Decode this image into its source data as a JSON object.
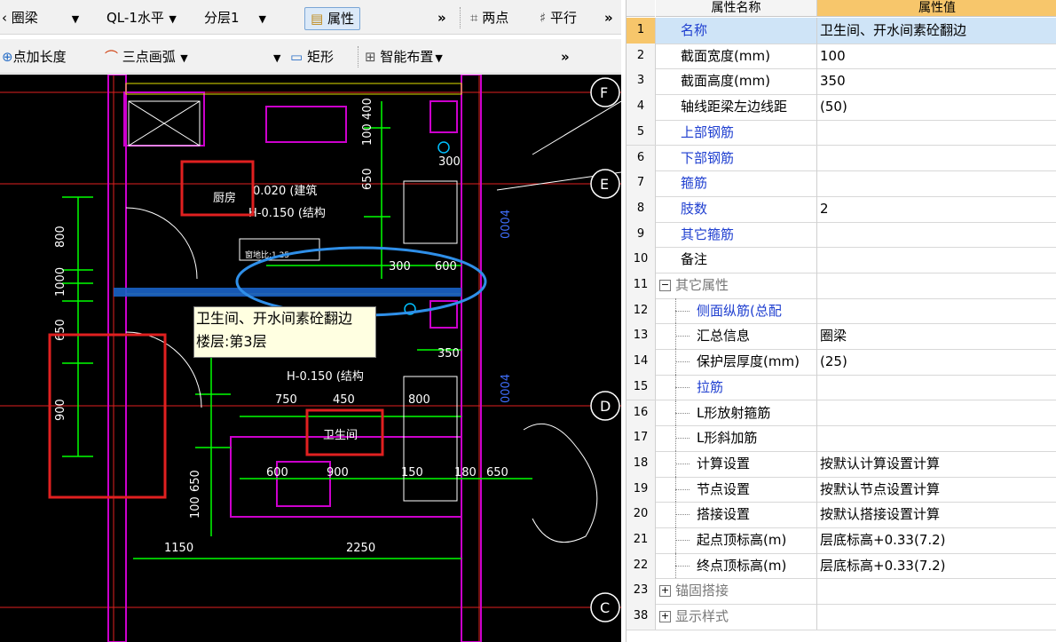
{
  "toolbar1": {
    "type_label": "圈梁",
    "code_label": "QL-1水平",
    "layer_label": "分层1",
    "properties_label": "属性",
    "two_point_label": "两点",
    "parallel_label": "平行"
  },
  "toolbar2": {
    "point_length_label": "点加长度",
    "three_point_arc_label": "三点画弧",
    "rect_label": "矩形",
    "smart_layout_label": "智能布置"
  },
  "cad": {
    "axis_labels": [
      "F",
      "E",
      "D",
      "C"
    ],
    "room_kitchen": "厨房",
    "room_bathroom": "卫生间",
    "elev_built": "0.020 (建筑",
    "elev_struct": "H-0.150 (结构",
    "elev_struct2": "H-0.150 (结构",
    "ratio_label": "窗地比:1.25",
    "dims": [
      "800",
      "1000",
      "650",
      "900",
      "650",
      "100",
      "1150",
      "2250",
      "750",
      "450",
      "800",
      "300",
      "600",
      "350",
      "300",
      "100 400",
      "650",
      "600",
      "600",
      "900",
      "150",
      "180",
      "650"
    ],
    "vertical_dims": [
      "0004",
      "0004"
    ]
  },
  "tooltip": {
    "line1": "卫生间、开水间素砼翻边",
    "line2": "楼层:第3层"
  },
  "panel": {
    "header_name": "属性名称",
    "header_value": "属性值",
    "rows": [
      {
        "num": "1",
        "name": "名称",
        "value": "卫生间、开水间素砼翻边",
        "style": "blue",
        "selected": true
      },
      {
        "num": "2",
        "name": "截面宽度(mm)",
        "value": "100",
        "style": "normal"
      },
      {
        "num": "3",
        "name": "截面高度(mm)",
        "value": "350",
        "style": "normal"
      },
      {
        "num": "4",
        "name": "轴线距梁左边线距",
        "value": "(50)",
        "style": "normal"
      },
      {
        "num": "5",
        "name": "上部钢筋",
        "value": "",
        "style": "blue"
      },
      {
        "num": "6",
        "name": "下部钢筋",
        "value": "",
        "style": "blue"
      },
      {
        "num": "7",
        "name": "箍筋",
        "value": "",
        "style": "blue"
      },
      {
        "num": "8",
        "name": "肢数",
        "value": "2",
        "style": "blue"
      },
      {
        "num": "9",
        "name": "其它箍筋",
        "value": "",
        "style": "blue"
      },
      {
        "num": "10",
        "name": "备注",
        "value": "",
        "style": "normal"
      },
      {
        "num": "11",
        "name": "其它属性",
        "value": "",
        "style": "group",
        "expander": "−"
      },
      {
        "num": "12",
        "name": "侧面纵筋(总配",
        "value": "",
        "style": "blue-child"
      },
      {
        "num": "13",
        "name": "汇总信息",
        "value": "圈梁",
        "style": "child"
      },
      {
        "num": "14",
        "name": "保护层厚度(mm)",
        "value": "(25)",
        "style": "child"
      },
      {
        "num": "15",
        "name": "拉筋",
        "value": "",
        "style": "blue-child"
      },
      {
        "num": "16",
        "name": "L形放射箍筋",
        "value": "",
        "style": "child"
      },
      {
        "num": "17",
        "name": "L形斜加筋",
        "value": "",
        "style": "child"
      },
      {
        "num": "18",
        "name": "计算设置",
        "value": "按默认计算设置计算",
        "style": "child"
      },
      {
        "num": "19",
        "name": "节点设置",
        "value": "按默认节点设置计算",
        "style": "child"
      },
      {
        "num": "20",
        "name": "搭接设置",
        "value": "按默认搭接设置计算",
        "style": "child"
      },
      {
        "num": "21",
        "name": "起点顶标高(m)",
        "value": "层底标高+0.33(7.2)",
        "style": "child"
      },
      {
        "num": "22",
        "name": "终点顶标高(m)",
        "value": "层底标高+0.33(7.2)",
        "style": "child"
      },
      {
        "num": "23",
        "name": "锚固搭接",
        "value": "",
        "style": "group",
        "expander": "+"
      },
      {
        "num": "38",
        "name": "显示样式",
        "value": "",
        "style": "group",
        "expander": "+"
      }
    ]
  },
  "colors": {
    "accent_select": "#cfe4f7",
    "row_number_selected": "#f7c66b",
    "annotation_red": "#e02020",
    "annotation_blue": "#2f8fe8",
    "cad_green": "#00ff00",
    "cad_magenta": "#ff00ff",
    "cad_yellow": "#e0e000"
  }
}
